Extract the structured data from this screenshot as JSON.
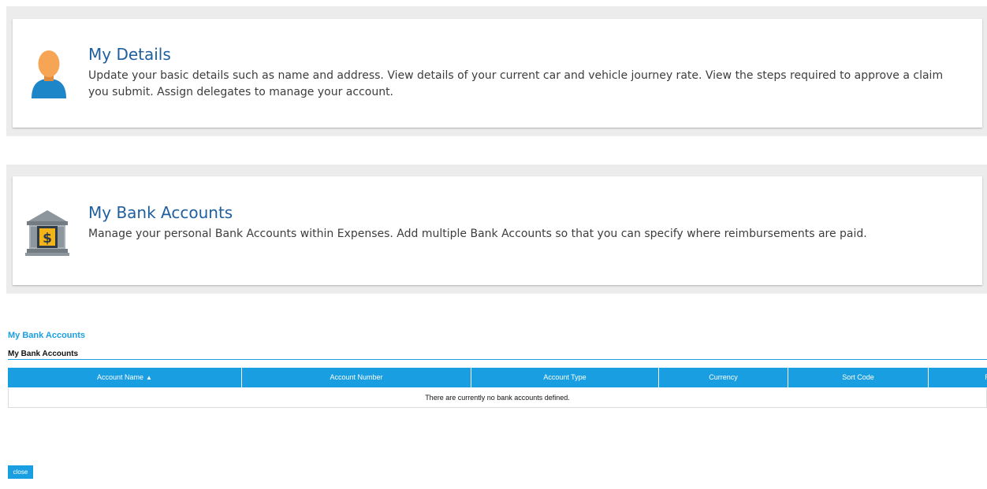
{
  "panels": [
    {
      "title": "My Details",
      "description": "Update your basic details such as name and address. View details of your current car and vehicle journey rate. View the steps required to approve a claim you submit. Assign delegates to manage your account.",
      "icon": "user-icon"
    },
    {
      "title": "My Bank Accounts",
      "description": "Manage your personal Bank Accounts within Expenses. Add multiple Bank Accounts so that you can specify where reimbursements are paid.",
      "icon": "bank-icon"
    }
  ],
  "bank_section": {
    "title": "My Bank Accounts",
    "subtitle": "My Bank Accounts",
    "columns": [
      "Account Name",
      "Account Number",
      "Account Type",
      "Currency",
      "Sort Code",
      "R"
    ],
    "sort_indicator": "▲",
    "empty_message": "There are currently no bank accounts defined."
  },
  "close_label": "close",
  "colors": {
    "accent": "#1a9ee2",
    "title_blue": "#1f5f9e",
    "panel_background": "#ececec"
  }
}
